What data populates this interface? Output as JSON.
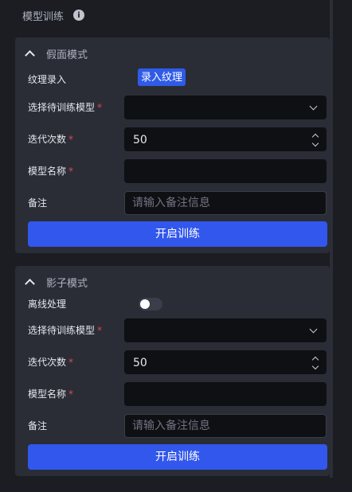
{
  "page": {
    "title": "模型训练"
  },
  "sections": [
    {
      "title": "假面模式",
      "texture": {
        "label": "纹理录入",
        "button": "录入纹理"
      },
      "model_select": {
        "label": "选择待训练模型",
        "value": ""
      },
      "iterations": {
        "label": "迭代次数",
        "value": "50"
      },
      "model_name": {
        "label": "模型名称",
        "value": ""
      },
      "note": {
        "label": "备注",
        "placeholder": "请输入备注信息"
      },
      "submit": "开启训练"
    },
    {
      "title": "影子模式",
      "offline": {
        "label": "离线处理",
        "enabled": false
      },
      "model_select": {
        "label": "选择待训练模型",
        "value": ""
      },
      "iterations": {
        "label": "迭代次数",
        "value": "50"
      },
      "model_name": {
        "label": "模型名称",
        "value": ""
      },
      "note": {
        "label": "备注",
        "placeholder": "请输入备注信息"
      },
      "submit": "开启训练"
    }
  ],
  "required_mark": "*",
  "colors": {
    "accent": "#3257ec",
    "required": "#e0474b",
    "panel": "#2a2d36",
    "background": "#1b1d23"
  }
}
